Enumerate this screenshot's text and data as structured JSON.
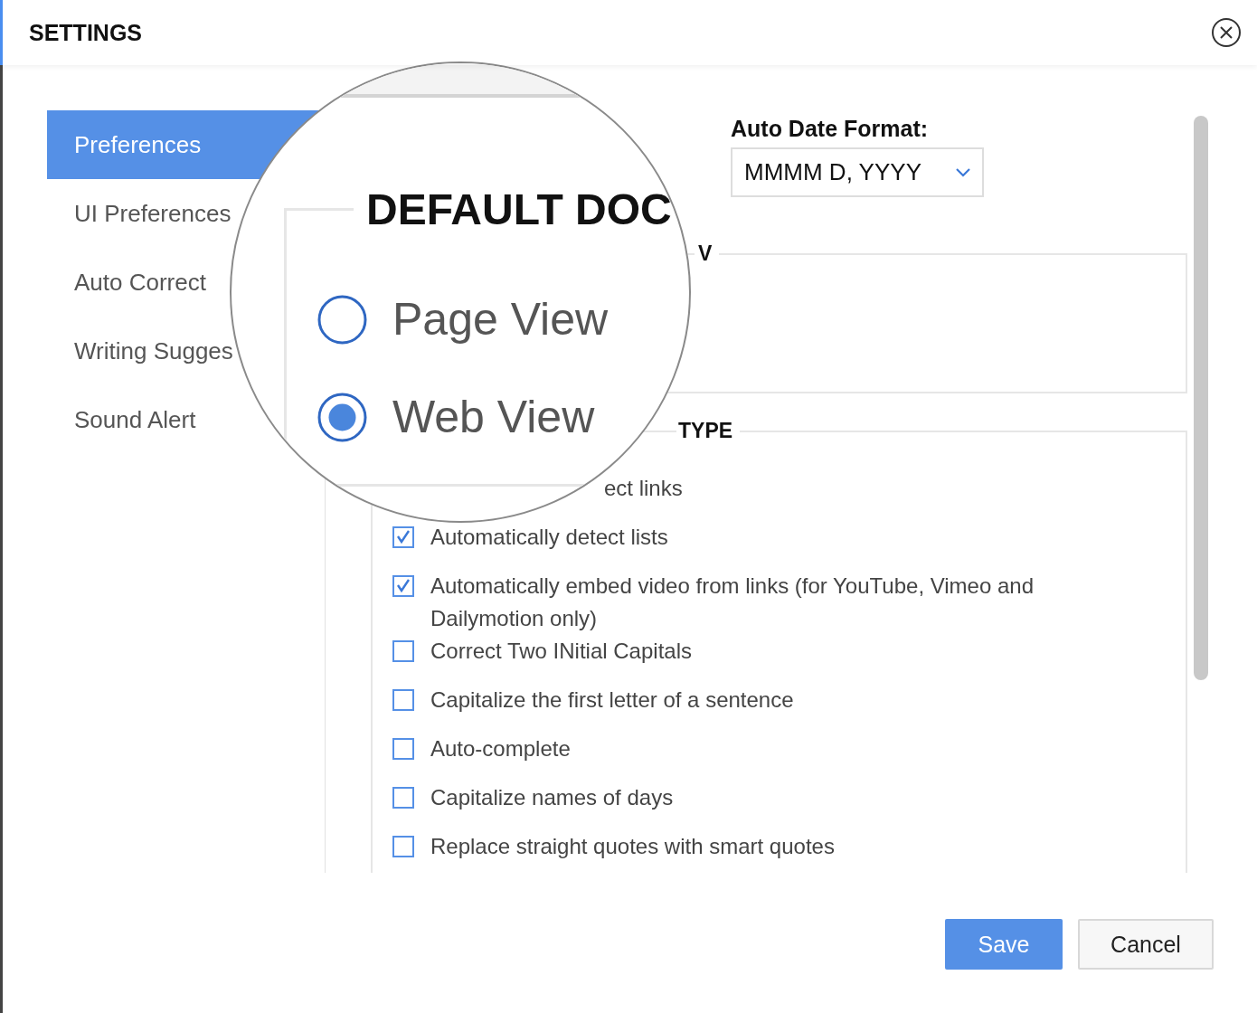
{
  "window": {
    "title": "SETTINGS"
  },
  "sidebar": {
    "items": [
      {
        "label": "Preferences",
        "selected": true
      },
      {
        "label": "UI Preferences",
        "selected": false
      },
      {
        "label": "Auto Correct",
        "selected": false
      },
      {
        "label": "Writing Sugges",
        "selected": false
      },
      {
        "label": "Sound Alert",
        "selected": false
      }
    ]
  },
  "date_format": {
    "label": "Auto Date Format:",
    "value": "MMMM D, YYYY"
  },
  "view_section": {
    "heading": "V"
  },
  "type_section": {
    "heading": "TYPE",
    "options": [
      {
        "kind": "fragment",
        "label": "ect links"
      },
      {
        "kind": "checkbox",
        "label": "Automatically detect lists",
        "checked": true
      },
      {
        "kind": "checkbox",
        "label": "Automatically embed video from links (for YouTube, Vimeo and Dailymotion only)",
        "checked": true
      },
      {
        "kind": "checkbox",
        "label": "Correct Two INitial Capitals",
        "checked": false
      },
      {
        "kind": "checkbox",
        "label": "Capitalize the first letter of a sentence",
        "checked": false
      },
      {
        "kind": "checkbox",
        "label": "Auto-complete",
        "checked": false
      },
      {
        "kind": "checkbox",
        "label": "Capitalize names of days",
        "checked": false
      },
      {
        "kind": "checkbox",
        "label": "Replace straight quotes with smart quotes",
        "checked": false
      }
    ]
  },
  "magnifier": {
    "heading": "DEFAULT DOC",
    "options": [
      {
        "label": "Page View",
        "selected": false
      },
      {
        "label": "Web View",
        "selected": true
      }
    ]
  },
  "buttons": [
    {
      "label": "Save",
      "kind": "primary"
    },
    {
      "label": "Cancel",
      "kind": "secondary"
    }
  ]
}
